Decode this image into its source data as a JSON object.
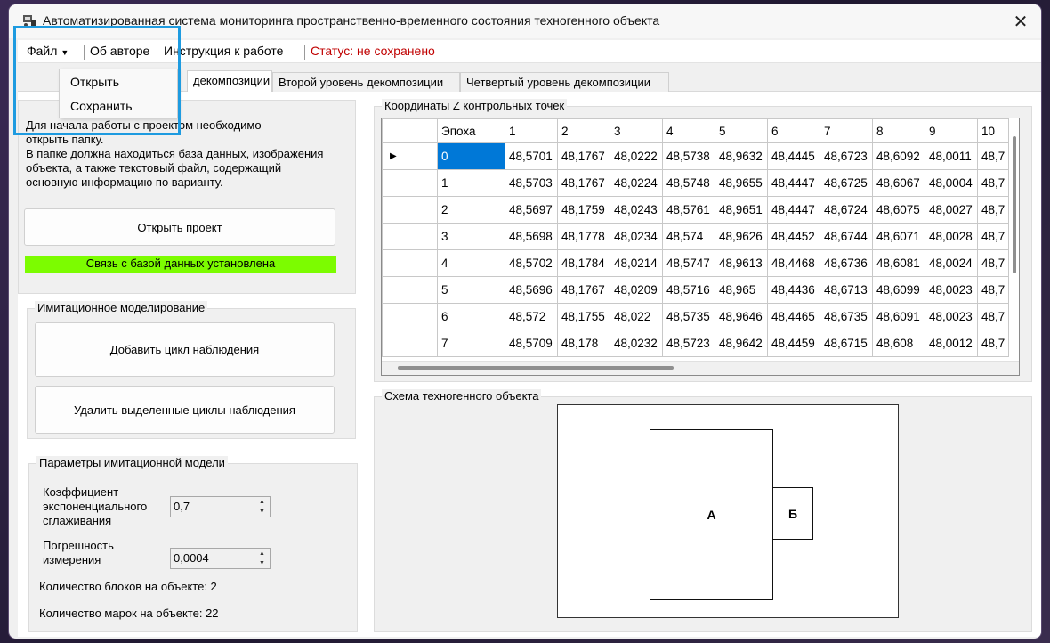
{
  "window": {
    "title": "Автоматизированная система мониторинга пространственно-временного состояния техногенного объекта",
    "icon": "app-icon",
    "close_glyph": "✕"
  },
  "menubar": {
    "file": "Файл",
    "about": "Об авторе",
    "instructions": "Инструкция к работе",
    "status": "Статус: не сохранено"
  },
  "file_menu": {
    "items": [
      "Открыть",
      "Сохранить"
    ]
  },
  "tabs": [
    {
      "label": "декомпозиции",
      "active": true
    },
    {
      "label": "Второй уровень декомпозиции",
      "active": false
    },
    {
      "label": "Четвертый уровень декомпозиции",
      "active": false
    }
  ],
  "project": {
    "text_lines": [
      "Для начала работы с проектом необходимо",
      "открыть папку.",
      "В папке должна находиться база данных, изображения",
      "объекта, а также текстовый файл, содержащий",
      "основную информацию по варианту."
    ],
    "open_button": "Открыть проект",
    "db_status": "Связь с базой данных установлена",
    "db_status_color": "#7cfc00"
  },
  "simulation": {
    "title": "Имитационное моделирование",
    "add_button": "Добавить цикл наблюдения",
    "delete_button": "Удалить выделенные циклы наблюдения"
  },
  "params": {
    "title": "Параметры имитационной модели",
    "smoothing_label": [
      "Коэффициент",
      "экспоненциального",
      "сглаживания"
    ],
    "smoothing_value": "0,7",
    "error_label": [
      "Погрешность",
      "измерения"
    ],
    "error_value": "0,0004",
    "blocks_count": "Количество блоков на объекте: 2",
    "marks_count": "Количество марок на объекте: 22"
  },
  "grid": {
    "title": "Координаты Z контрольных точек",
    "columns": [
      "Эпоха",
      "1",
      "2",
      "3",
      "4",
      "5",
      "6",
      "7",
      "8",
      "9",
      "10"
    ],
    "rows": [
      [
        "0",
        "48,5701",
        "48,1767",
        "48,0222",
        "48,5738",
        "48,9632",
        "48,4445",
        "48,6723",
        "48,6092",
        "48,0011",
        "48,7"
      ],
      [
        "1",
        "48,5703",
        "48,1767",
        "48,0224",
        "48,5748",
        "48,9655",
        "48,4447",
        "48,6725",
        "48,6067",
        "48,0004",
        "48,7"
      ],
      [
        "2",
        "48,5697",
        "48,1759",
        "48,0243",
        "48,5761",
        "48,9651",
        "48,4447",
        "48,6724",
        "48,6075",
        "48,0027",
        "48,7"
      ],
      [
        "3",
        "48,5698",
        "48,1778",
        "48,0234",
        "48,574",
        "48,9626",
        "48,4452",
        "48,6744",
        "48,6071",
        "48,0028",
        "48,7"
      ],
      [
        "4",
        "48,5702",
        "48,1784",
        "48,0214",
        "48,5747",
        "48,9613",
        "48,4468",
        "48,6736",
        "48,6081",
        "48,0024",
        "48,7"
      ],
      [
        "5",
        "48,5696",
        "48,1767",
        "48,0209",
        "48,5716",
        "48,965",
        "48,4436",
        "48,6713",
        "48,6099",
        "48,0023",
        "48,7"
      ],
      [
        "6",
        "48,572",
        "48,1755",
        "48,022",
        "48,5735",
        "48,9646",
        "48,4465",
        "48,6735",
        "48,6091",
        "48,0023",
        "48,7"
      ],
      [
        "7",
        "48,5709",
        "48,178",
        "48,0232",
        "48,5723",
        "48,9642",
        "48,4459",
        "48,6715",
        "48,608",
        "48,0012",
        "48,7"
      ]
    ],
    "current_row_glyph": "▶",
    "selected_row": 0
  },
  "scheme": {
    "title": "Схема техногенного объекта",
    "block_a": "А",
    "block_b": "Б"
  }
}
